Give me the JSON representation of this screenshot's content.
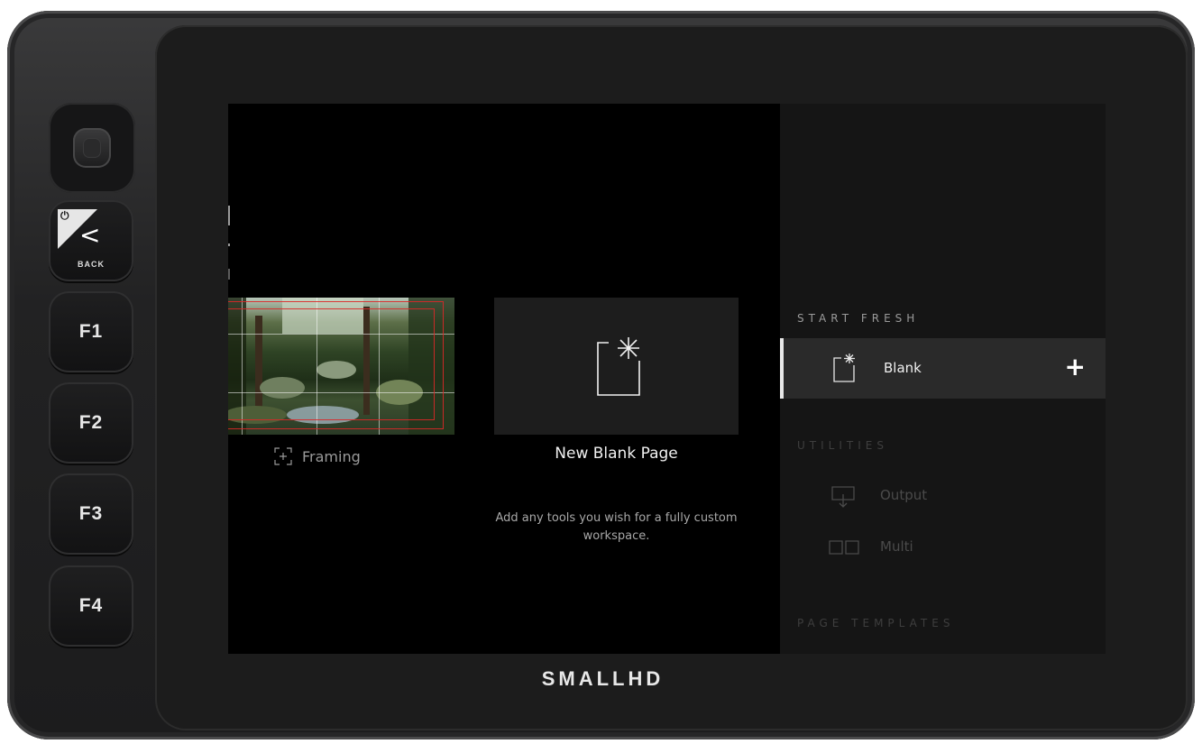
{
  "brand": "SMALLHD",
  "buttons": {
    "back": "BACK",
    "power_glyph": "⏻",
    "back_glyph": "<",
    "f1": "F1",
    "f2": "F2",
    "f3": "F3",
    "f4": "F4"
  },
  "preview": {
    "framing_caption": "Framing",
    "new_page_title": "New Blank Page",
    "new_page_description": "Add any tools you wish for a fully custom workspace."
  },
  "panel": {
    "start_fresh_heading": "START FRESH",
    "blank_label": "Blank",
    "add_glyph": "+",
    "utilities_heading": "UTILITIES",
    "output_label": "Output",
    "multi_label": "Multi",
    "page_templates_heading": "PAGE TEMPLATES"
  },
  "colors": {
    "screen_bg": "#000000",
    "panel_bg": "#151515",
    "selected_row_bg": "#2a2a2a",
    "dim_text": "#4a4a4a",
    "heading_text": "#9a9a9a"
  },
  "icons": [
    "joystick-icon",
    "power-icon",
    "back-chevron-icon",
    "focus-frame-icon",
    "blank-page-icon",
    "output-icon",
    "multi-icon",
    "plus-icon"
  ]
}
